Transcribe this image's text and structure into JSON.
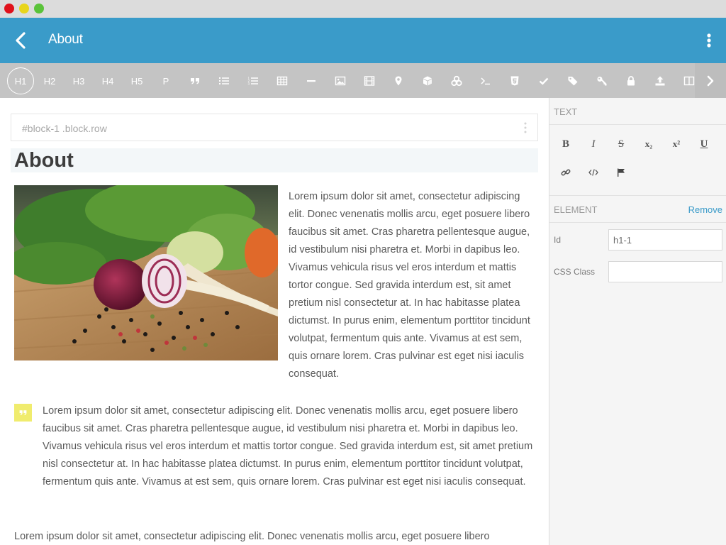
{
  "window": {
    "controls": [
      "close",
      "minimize",
      "maximize"
    ]
  },
  "appbar": {
    "title": "About",
    "back_icon": "chevron-left-icon",
    "menu_icon": "more-vertical-icon",
    "color": "#3a9bc9"
  },
  "toolbar": {
    "items": [
      {
        "label": "H1",
        "active": true
      },
      {
        "label": "H2"
      },
      {
        "label": "H3"
      },
      {
        "label": "H4"
      },
      {
        "label": "H5"
      },
      {
        "label": "P"
      }
    ],
    "icons": [
      "quote-icon",
      "bullet-list-icon",
      "numbered-list-icon",
      "table-icon",
      "horizontal-rule-icon",
      "image-icon",
      "video-icon",
      "map-pin-icon",
      "cube-icon",
      "cubes-icon",
      "terminal-icon",
      "html5-icon",
      "check-icon",
      "tags-icon",
      "key-icon",
      "lock-icon",
      "upload-icon",
      "columns-icon"
    ],
    "next_icon": "chevron-right-icon"
  },
  "editor": {
    "selector": "#block-1 .block.row",
    "heading": "About",
    "paragraph1": "Lorem ipsum dolor sit amet, consectetur adipiscing elit. Donec venenatis mollis arcu, eget posuere libero faucibus sit amet. Cras pharetra pellentesque augue, id vestibulum nisi pharetra et. Morbi in dapibus leo. Vivamus vehicula risus vel eros interdum et mattis tortor congue. Sed gravida interdum est, sit amet pretium nisl consectetur at. In hac habitasse platea dictumst. In purus enim, elementum porttitor tincidunt volutpat, fermentum quis ante. Vivamus at est sem, quis ornare lorem. Cras pulvinar est eget nisi iaculis consequat.",
    "quote": "Lorem ipsum dolor sit amet, consectetur adipiscing elit. Donec venenatis mollis arcu, eget posuere libero faucibus sit amet. Cras pharetra pellentesque augue, id vestibulum nisi pharetra et. Morbi in dapibus leo. Vivamus vehicula risus vel eros interdum et mattis tortor congue. Sed gravida interdum est, sit amet pretium nisl consectetur at. In hac habitasse platea dictumst. In purus enim, elementum porttitor tincidunt volutpat, fermentum quis ante. Vivamus at est sem, quis ornare lorem. Cras pulvinar est eget nisi iaculis consequat.",
    "paragraph2": "Lorem ipsum dolor sit amet, consectetur adipiscing elit. Donec venenatis mollis arcu, eget posuere libero",
    "quote_color": "#f0ec6e"
  },
  "panel": {
    "text_section": "TEXT",
    "format_buttons": [
      {
        "label": "B",
        "icon": "bold-icon"
      },
      {
        "label": "I",
        "icon": "italic-icon"
      },
      {
        "label": "S",
        "icon": "strikethrough-icon"
      },
      {
        "label": "x₂",
        "icon": "subscript-icon"
      },
      {
        "label": "x²",
        "icon": "superscript-icon"
      },
      {
        "label": "U",
        "icon": "underline-icon"
      }
    ],
    "extra_icons": [
      "link-icon",
      "code-icon",
      "flag-icon"
    ],
    "element_section": "ELEMENT",
    "remove_label": "Remove",
    "id_label": "Id",
    "id_value": "h1-1",
    "class_label": "CSS Class",
    "class_value": ""
  }
}
